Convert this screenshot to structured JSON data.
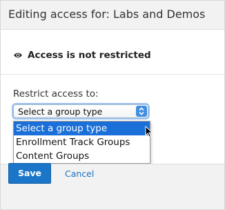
{
  "header": {
    "title": "Editing access for: Labs and Demos"
  },
  "status": {
    "icon": "eye-icon",
    "text": "Access is not restricted"
  },
  "restrict": {
    "label": "Restrict access to:",
    "select_value": "Select a group type",
    "options": [
      {
        "label": "Select a group type",
        "selected": true
      },
      {
        "label": "Enrollment Track Groups",
        "selected": false
      },
      {
        "label": "Content Groups",
        "selected": false
      }
    ]
  },
  "footer": {
    "save_label": "Save",
    "cancel_label": "Cancel"
  },
  "colors": {
    "accent": "#1b75c9",
    "selection": "#1a6fd8",
    "link": "#1b6fc0"
  }
}
